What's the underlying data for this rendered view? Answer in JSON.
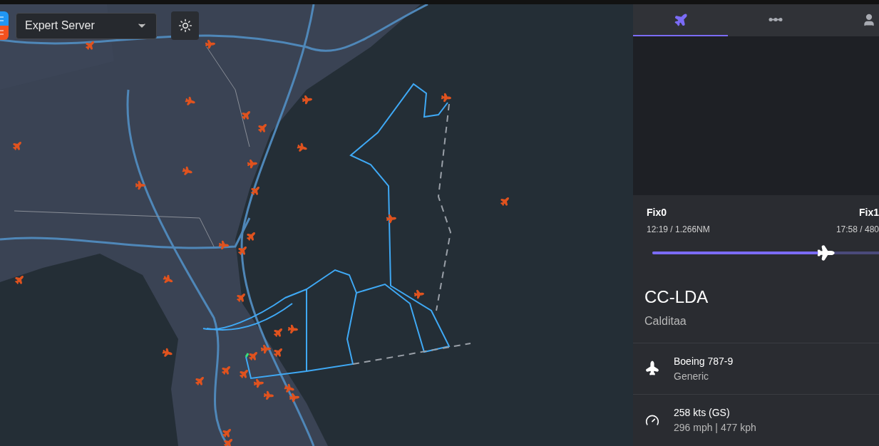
{
  "server_select": {
    "value": "Expert Server"
  },
  "panel": {
    "tabs": [
      {
        "kind": "flight",
        "selected": true
      },
      {
        "kind": "route",
        "selected": false
      },
      {
        "kind": "user",
        "selected": false
      }
    ],
    "route_progress": {
      "origin": {
        "name": "Fix0",
        "detail": "12:19 / 1.266NM"
      },
      "destination": {
        "name": "Fix1",
        "detail": "17:58 / 480"
      },
      "level": 0.76
    },
    "callsign": "CC-LDA",
    "pilot": "Calditaa",
    "details": [
      {
        "kind": "aircraft",
        "title": "Boeing 787-9",
        "subtitle": "Generic"
      },
      {
        "kind": "speed",
        "title": "258 kts (GS)",
        "subtitle": "296 mph | 477 kph"
      }
    ]
  }
}
